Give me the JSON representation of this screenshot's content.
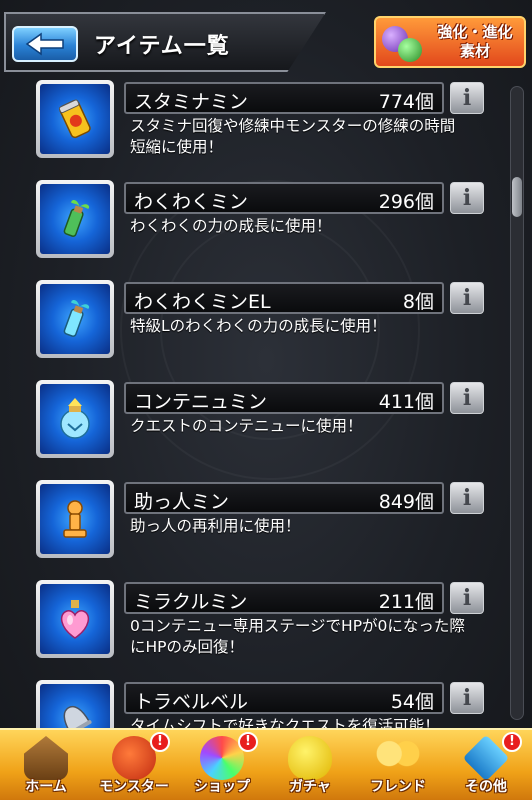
{
  "header": {
    "title": "アイテム一覧",
    "back_icon": "back-arrow-icon",
    "evolve_button": {
      "line1": "強化・進化",
      "line2": "素材"
    }
  },
  "items": [
    {
      "name": "スタミナミン",
      "count": "774個",
      "desc": "スタミナ回復や修練中モンスターの修練の時間短縮に使用！",
      "icon": "stamina-can-icon"
    },
    {
      "name": "わくわくミン",
      "count": "296個",
      "desc": "わくわくの力の成長に使用！",
      "icon": "sprout-bottle-icon"
    },
    {
      "name": "わくわくミンEL",
      "count": "8個",
      "desc": "特級Lのわくわくの力の成長に使用！",
      "icon": "sprout-bottle-el-icon"
    },
    {
      "name": "コンテニュミン",
      "count": "411個",
      "desc": "クエストのコンテニューに使用！",
      "icon": "continue-jar-icon"
    },
    {
      "name": "助っ人ミン",
      "count": "849個",
      "desc": "助っ人の再利用に使用！",
      "icon": "helper-pawn-icon"
    },
    {
      "name": "ミラクルミン",
      "count": "211個",
      "desc": "0コンテニュー専用ステージでHPが0になった際にHPのみ回復！",
      "icon": "heart-potion-icon"
    },
    {
      "name": "トラベルベル",
      "count": "54個",
      "desc": "タイムシフトで好きなクエストを復活可能！",
      "icon": "bell-icon"
    }
  ],
  "info_label": "i",
  "bottom_nav": [
    {
      "label": "ホーム",
      "badge": ""
    },
    {
      "label": "モンスター",
      "badge": "!"
    },
    {
      "label": "ショップ",
      "badge": "!"
    },
    {
      "label": "ガチャ",
      "badge": ""
    },
    {
      "label": "フレンド",
      "badge": ""
    },
    {
      "label": "その他",
      "badge": "!"
    }
  ]
}
